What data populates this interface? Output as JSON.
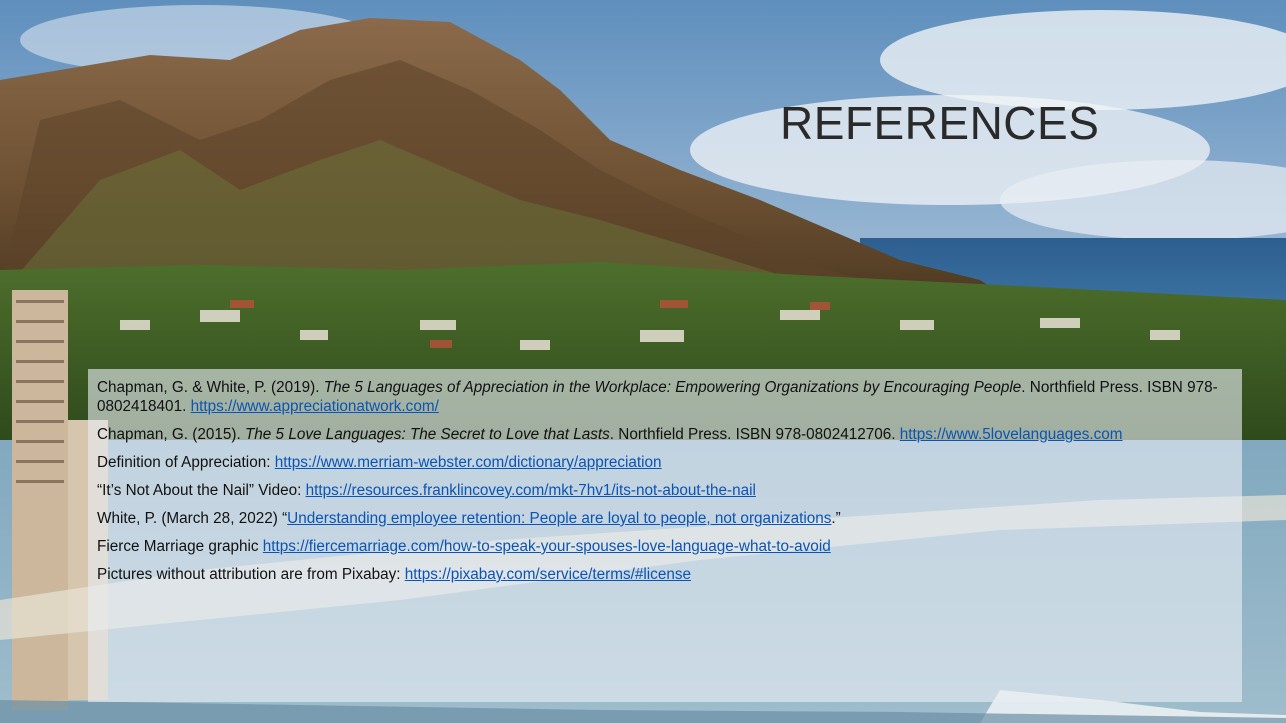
{
  "slide": {
    "title": "REFERENCES",
    "references": [
      {
        "pre": "Chapman, G. & White, P. (2019). ",
        "title": "The 5 Languages of Appreciation in the Workplace: Empowering Organizations by Encouraging People",
        "post": ". Northfield Press. ISBN 978-0802418401. ",
        "link": "https://www.appreciationatwork.com/",
        "tail": ""
      },
      {
        "pre": "Chapman, G. (2015). ",
        "title": "The 5 Love Languages: The Secret to Love that Lasts",
        "post": ". Northfield Press. ISBN 978-0802412706. ",
        "link": "https://www.5lovelanguages.com",
        "tail": ""
      },
      {
        "pre": "Definition of Appreciation: ",
        "title": "",
        "post": "",
        "link": "https://www.merriam-webster.com/dictionary/appreciation",
        "tail": ""
      },
      {
        "pre": "“It’s Not About the Nail” Video:  ",
        "title": "",
        "post": "",
        "link": "https://resources.franklincovey.com/mkt-7hv1/its-not-about-the-nail",
        "tail": ""
      },
      {
        "pre": "White, P. (March 28, 2022) “",
        "title": "",
        "post": "",
        "link": "Understanding employee retention:  People are loyal to people, not organizations",
        "tail": ".”"
      },
      {
        "pre": "Fierce Marriage graphic ",
        "title": "",
        "post": "",
        "link": "https://fiercemarriage.com/how-to-speak-your-spouses-love-language-what-to-avoid",
        "tail": ""
      },
      {
        "pre": "Pictures without attribution are from Pixabay:   ",
        "title": "",
        "post": "",
        "link": "https://pixabay.com/service/terms/#license",
        "tail": ""
      }
    ]
  },
  "colors": {
    "link": "#0b54b4",
    "text": "#111111",
    "title": "#2a2a2a"
  }
}
